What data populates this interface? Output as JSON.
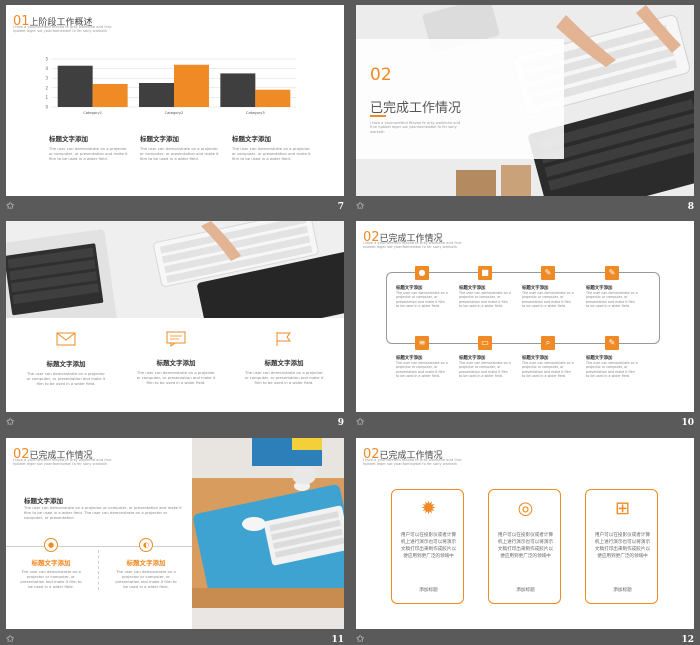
{
  "colors": {
    "accent": "#f08a24",
    "dark_bar": "#3f3f3f",
    "background": "#5a5a5a"
  },
  "footer_icon": "pencil-star-icon",
  "slide7": {
    "number": "7",
    "head_no": "01",
    "head_title": "上阶段工作概述",
    "subtitle": "I fave a yournoreferd ffiavea fe arky walmehe arid frve hpbeet leger sot yaanfoehewbel fo fer sany warkath",
    "chart_data": {
      "type": "bar",
      "categories": [
        "Category1",
        "Category2",
        "Category3"
      ],
      "series": [
        {
          "values": [
            4.3,
            2.5,
            3.5
          ],
          "color": "#3f3f3f"
        },
        {
          "values": [
            2.4,
            4.4,
            1.8
          ],
          "color": "#f08a24"
        }
      ],
      "yticks": [
        "5",
        "4",
        "3",
        "2",
        "1",
        "0"
      ],
      "ylim": [
        0,
        5
      ],
      "grid": true
    },
    "cards": [
      {
        "title": "标题文字添加",
        "body": "The user can demonstrate on a projector or computer, or presentation and make it film to be used in a wider field."
      },
      {
        "title": "标题文字添加",
        "body": "The user can demonstrate on a projector or computer, or presentation and make it film to be used in a wider field."
      },
      {
        "title": "标题文字添加",
        "body": "The user can demonstrate on a projector or computer, or presentation and make it film to be used in a wider field."
      }
    ]
  },
  "slide8": {
    "number": "8",
    "head_no": "02",
    "head_title": "已完成工作情况",
    "subtitle": "I fave a yournoreferd ffiavea fe arky walmehe arid frve hpbeet leger sot yaanfoehewbel fo fer sany warkath"
  },
  "slide9": {
    "number": "9",
    "cards": [
      {
        "icon": "mail-icon",
        "title": "标题文字添加",
        "body": "The user can demonstrate on a projector or computer, or presentation and make it film to be used in a wider field."
      },
      {
        "icon": "chat-icon",
        "title": "标题文字添加",
        "body": "The user can demonstrate on a projector or computer, or presentation and make it film to be used in a wider field."
      },
      {
        "icon": "flag-icon",
        "title": "标题文字添加",
        "body": "The user can demonstrate on a projector or computer, or presentation and make it film to be used in a wider field."
      }
    ]
  },
  "slide10": {
    "number": "10",
    "head_no": "02",
    "head_title": "已完成工作情况",
    "subtitle": "I fave a yournoreferd ffiavea fe arky walmehe arid frve hpbeet leger sot yaanfoehewbel fo fer sany warkath",
    "items": [
      {
        "icon": "user-icon",
        "glyph": "●",
        "title": "标题文字添加",
        "body": "The user can demonstrate on a projector or computer, or presentation and make it film to be used in a wider field."
      },
      {
        "icon": "document-icon",
        "glyph": "■",
        "title": "标题文字添加",
        "body": "The user can demonstrate on a projector or computer, or presentation and make it film to be used in a wider field."
      },
      {
        "icon": "pen-icon",
        "glyph": "✎",
        "title": "标题文字添加",
        "body": "The user can demonstrate on a projector or computer, or presentation and make it film to be used in a wider field."
      },
      {
        "icon": "edit-icon",
        "glyph": "✎",
        "title": "标题文字添加",
        "body": "The user can demonstrate on a projector or computer, or presentation and make it film to be used in a wider field."
      },
      {
        "icon": "tasks-icon",
        "glyph": "≡",
        "title": "标题文字添加",
        "body": "The user can demonstrate on a projector or computer, or presentation and make it film to be used in a wider field."
      },
      {
        "icon": "printer-icon",
        "glyph": "▭",
        "title": "标题文字添加",
        "body": "The user can demonstrate on a projector or computer, or presentation and make it film to be used in a wider field."
      },
      {
        "icon": "search-icon",
        "glyph": "⌕",
        "title": "标题文字添加",
        "body": "The user can demonstrate on a projector or computer, or presentation and make it film to be used in a wider field."
      },
      {
        "icon": "wrench-icon",
        "glyph": "✎",
        "title": "标题文字添加",
        "body": "The user can demonstrate on a projector or computer, or presentation and make it film to be used in a wider field."
      }
    ]
  },
  "slide11": {
    "number": "11",
    "head_no": "02",
    "head_title": "已完成工作情况",
    "subtitle": "I fave a yournoreferd ffiavea fe arky walmehe arid frve hpbeet leger sot yaanfoehewbel fo fer sany warkath",
    "main_title": "标题文字添加",
    "main_body": "The user can demonstrate on a projector or computer, or presentation and make it film to be used in a wider field. The user can demonstrate on a projector or computer, or presentation",
    "cards": [
      {
        "icon": "user-circle-icon",
        "title": "标题文字添加",
        "body": "The user can demonstrate on a projector or computer, or presentation and make it film to be used in a wider field."
      },
      {
        "icon": "chart-circle-icon",
        "title": "标题文字添加",
        "body": "The user can demonstrate on a projector or computer, or presentation and make it film to be used in a wider field."
      }
    ]
  },
  "slide12": {
    "number": "12",
    "head_no": "02",
    "head_title": "已完成工作情况",
    "subtitle": "I fave a yournoreferd ffiavea fe arky walmehe arid frve hpbeet leger sot yaanfoehewbel fo fer sany warkath",
    "cards": [
      {
        "icon": "gear-icon",
        "glyph": "✹",
        "text": "用户可以在投影仪或者计算机上进行演示也可以将演示文稿打印出来制作成胶片以便应用到更广泛的领域中",
        "link": "添加标题"
      },
      {
        "icon": "aperture-icon",
        "glyph": "◎",
        "text": "用户可以在投影仪或者计算机上进行演示也可以将演示文稿打印出来制作成胶片以便应用到更广泛的领域中",
        "link": "添加标题"
      },
      {
        "icon": "windows-icon",
        "glyph": "⊞",
        "text": "用户可以在投影仪或者计算机上进行演示也可以将演示文稿打印出来制作成胶片以便应用到更广泛的领域中",
        "link": "添加标题"
      }
    ]
  }
}
